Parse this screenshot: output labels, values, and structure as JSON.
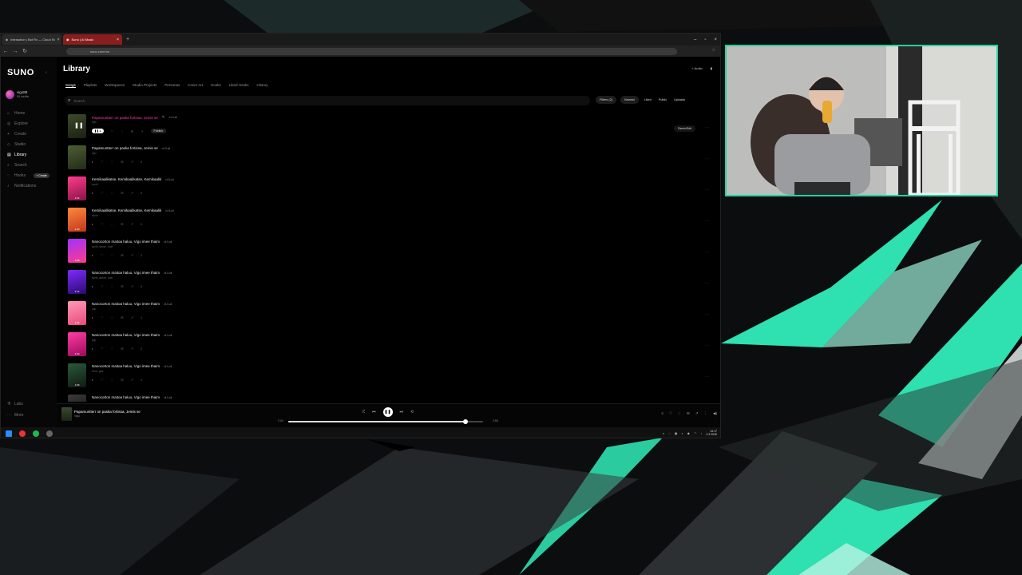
{
  "browser": {
    "tabs": [
      {
        "label": "Interaction | Bot Rx — Cloud St",
        "active": false
      },
      {
        "label": "Suno | AI Music",
        "active": true
      }
    ],
    "url": "suno.com/me"
  },
  "sidebar": {
    "logo": "SUNO",
    "username": "vigo88",
    "credits": "50 credits",
    "items": [
      {
        "label": "Home",
        "icon": "home-icon"
      },
      {
        "label": "Explore",
        "icon": "compass-icon"
      },
      {
        "label": "Create",
        "icon": "plus-icon"
      },
      {
        "label": "Studio",
        "icon": "studio-icon"
      },
      {
        "label": "Library",
        "icon": "library-icon"
      },
      {
        "label": "Search",
        "icon": "search-icon"
      },
      {
        "label": "Hooks",
        "icon": "hooks-icon"
      },
      {
        "label": "Notifications",
        "icon": "bell-icon"
      }
    ],
    "create_pill": "+ Create",
    "bottom": [
      {
        "label": "Labs"
      },
      {
        "label": "More"
      }
    ]
  },
  "main": {
    "title": "Library",
    "audio_button": "+ Audio",
    "tabs": [
      "Songs",
      "Playlists",
      "Workspaces",
      "Studio Projects",
      "Personas",
      "Cover Art",
      "Hooks",
      "Liked Hooks",
      "History"
    ],
    "active_tab": "Songs",
    "search_placeholder": "Search",
    "filters": {
      "filter": "Filters (2)",
      "sort": "Newest",
      "liked": "Liked",
      "public": "Public",
      "uploads": "Uploads"
    }
  },
  "songs": [
    {
      "title": "Papamuntterr on paska fortissa, Jemis se",
      "version": "v4.5-all",
      "tags": "epic",
      "num": "",
      "playing": true,
      "publish": "Publish",
      "remix": "Remix/Edit",
      "duration": "",
      "colors": [
        "#3d4a2a",
        "#1a2012"
      ]
    },
    {
      "title": "Papamuntterr on paska fortissa, Jemis se",
      "version": "v4.5-all",
      "tags": "epic",
      "num": "0",
      "playing": false,
      "duration": "",
      "colors": [
        "#4f5e33",
        "#222c18"
      ]
    },
    {
      "title": "Kemikaalikatse, Kemikaalikatse, Kemikaalik",
      "version": "v4.5-all",
      "tags": "synth",
      "num": "0",
      "playing": false,
      "duration": "1:24",
      "colors": [
        "#ff3d8b",
        "#8a1247"
      ]
    },
    {
      "title": "Kemikaalikatse, Kemikaalikatse, Kemikaalik",
      "version": "v4.5-all",
      "tags": "synth",
      "num": "0",
      "playing": false,
      "duration": "1:20",
      "colors": [
        "#ff8a3a",
        "#c2361c"
      ]
    },
    {
      "title": "Nanocorton maitoa haluu, Vigo imee thaim",
      "version": "v4.5-all",
      "tags": "synth, dance, trust",
      "num": "2",
      "playing": false,
      "duration": "1:09",
      "colors": [
        "#a030ff",
        "#ff3d8b"
      ]
    },
    {
      "title": "Nanocorton maitoa haluu, Vigo imee thaim",
      "version": "v4.5-all",
      "tags": "synth, dance, trust",
      "num": "0",
      "playing": false,
      "duration": "1:14",
      "colors": [
        "#7b2cff",
        "#2a0a6e"
      ]
    },
    {
      "title": "Nanocorton maitoa haluu, Vigo imee thaim",
      "version": "v4.5-all",
      "tags": "pop",
      "num": "1",
      "playing": false,
      "duration": "1:44",
      "colors": [
        "#ff9ab8",
        "#e84a7a"
      ]
    },
    {
      "title": "Nanocorton maitoa haluu, Vigo imee thaim",
      "version": "v4.5-all",
      "tags": "pop",
      "num": "2",
      "playing": false,
      "duration": "1:20",
      "colors": [
        "#ff3da5",
        "#9a0a5a"
      ]
    },
    {
      "title": "Nanocorton maitoa haluu, Vigo imee thaim",
      "version": "v4.5-all",
      "tags": "Sci-fi, jazz",
      "num": "1",
      "playing": false,
      "duration": "1:09",
      "colors": [
        "#2a5a3a",
        "#101a12"
      ]
    },
    {
      "title": "Nanocorton maitoa haluu, Vigo imee thaim",
      "version": "v4.5-all",
      "tags": "",
      "num": "",
      "playing": false,
      "duration": "",
      "colors": [
        "#3a3a3a",
        "#111111"
      ]
    }
  ],
  "player": {
    "title": "Papamuntterr on paska fortissa, Jemis se",
    "artist": "Vigo",
    "elapsed": "2:00",
    "total": "2:55",
    "progress": 0.91
  },
  "taskbar": {
    "time": "14:17",
    "date": "2.3.2026"
  },
  "colors": {
    "accent": "#ff3da5",
    "webcam_border": "#23d3a0",
    "background_shape": "#2fe0b0"
  }
}
